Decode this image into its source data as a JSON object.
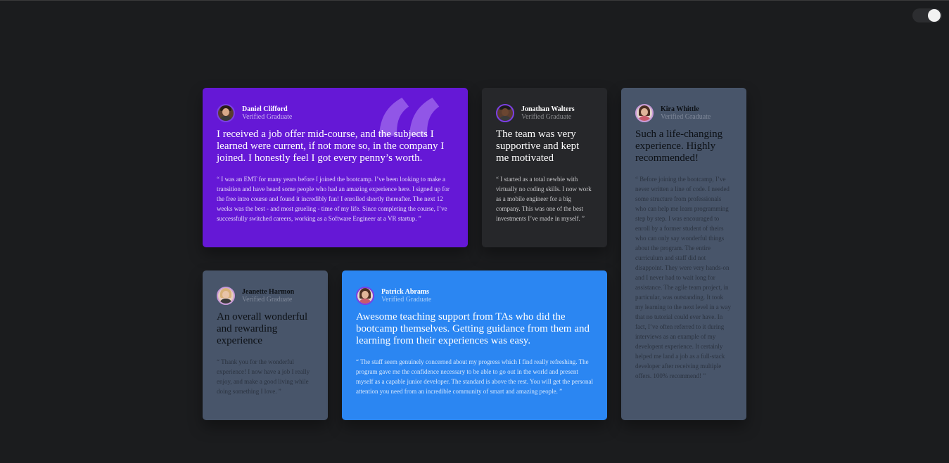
{
  "colors": {
    "background": "#1b1c1e",
    "card_purple": "#6518d6",
    "card_dark": "#26272a",
    "card_slate": "#48556a",
    "card_blue": "#2b86f2"
  },
  "theme_toggle": {
    "state": "on",
    "icon": "toggle-switch"
  },
  "testimonials": [
    {
      "name": "Daniel Clifford",
      "role": "Verified Graduate",
      "headline": "I received a job offer mid-course, and the subjects I learned were current, if not more so, in the company I joined. I honestly feel I got every penny’s worth.",
      "body": "“ I was an EMT for many years before I joined the bootcamp. I’ve been looking to make a transition and have heard some people who had an amazing experience here. I signed up for the free intro course and found it incredibly fun! I enrolled shortly thereafter. The next 12 weeks was the best - and most grueling - time of my life. Since completing the course, I’ve successfully switched careers, working as a Software Engineer at a VR startup. ”"
    },
    {
      "name": "Jonathan Walters",
      "role": "Verified Graduate",
      "headline": "The team was very supportive and kept me motivated",
      "body": "“ I started as a total newbie with virtually no coding skills. I now work as a mobile engineer for a big company. This was one of the best investments I’ve made in myself. ”"
    },
    {
      "name": "Kira Whittle",
      "role": "Verified Graduate",
      "headline": "Such a life-changing experience. Highly recommended!",
      "body": "“ Before joining the bootcamp, I’ve never written a line of code. I needed some structure from professionals who can help me learn programming step by step. I was encouraged to enroll by a former student of theirs who can only say wonderful things about the program. The entire curriculum and staff did not disappoint. They were very hands-on and I never had to wait long for assistance. The agile team project, in particular, was outstanding. It took my learning to the next level in a way that no tutorial could ever have. In fact, I’ve often referred to it during interviews as an example of my developent experience. It certainly helped me land a job as a full-stack developer after receiving multiple offers. 100% recommend! ”"
    },
    {
      "name": "Jeanette Harmon",
      "role": "Verified Graduate",
      "headline": "An overall wonderful and rewarding experience",
      "body": "“ Thank you for the wonderful experience! I now have a job I really enjoy, and make a good living while doing something I love. ”"
    },
    {
      "name": "Patrick Abrams",
      "role": "Verified Graduate",
      "headline": "Awesome teaching support from TAs who did the bootcamp themselves. Getting guidance from them and learning from their experiences was easy.",
      "body": "“ The staff seem genuinely concerned about my progress which I find really refreshing. The program gave me the confidence necessary to be able to go out in the world and present myself as a capable junior developer. The standard is above the rest. You will get the personal attention you need from an incredible community of smart and amazing people. ”"
    }
  ]
}
